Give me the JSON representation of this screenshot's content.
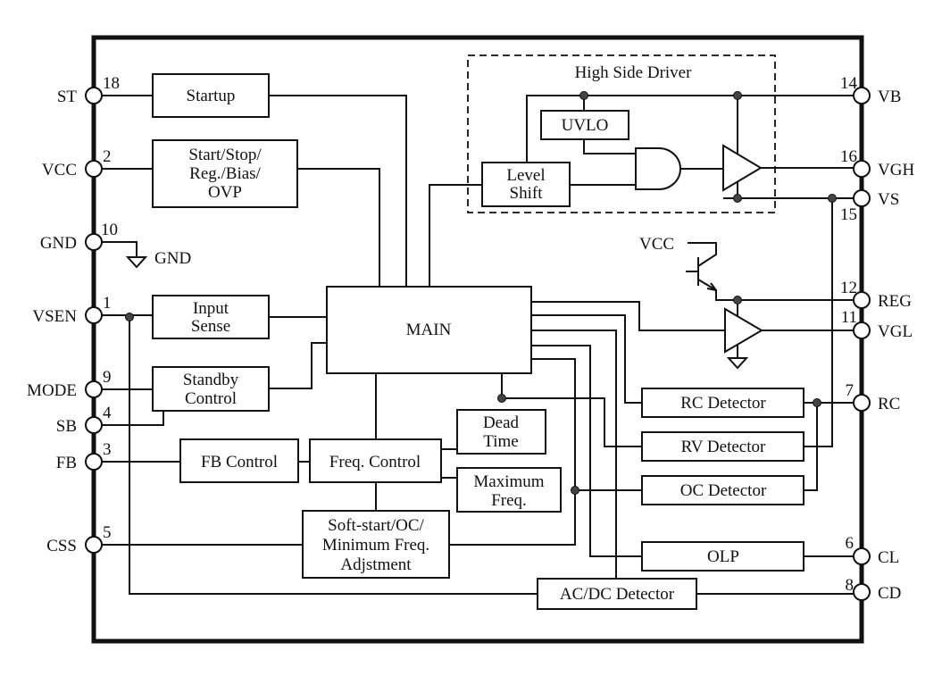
{
  "left_pins": [
    {
      "name": "ST",
      "num": "18"
    },
    {
      "name": "VCC",
      "num": "2"
    },
    {
      "name": "GND",
      "num": "10"
    },
    {
      "name": "VSEN",
      "num": "1"
    },
    {
      "name": "MODE",
      "num": "9"
    },
    {
      "name": "SB",
      "num": "4"
    },
    {
      "name": "FB",
      "num": "3"
    },
    {
      "name": "CSS",
      "num": "5"
    }
  ],
  "right_pins": [
    {
      "name": "VB",
      "num": "14"
    },
    {
      "name": "VGH",
      "num": "16"
    },
    {
      "name": "VS",
      "num": "15"
    },
    {
      "name": "REG",
      "num": "12"
    },
    {
      "name": "VGL",
      "num": "11"
    },
    {
      "name": "RC",
      "num": "7"
    },
    {
      "name": "CL",
      "num": "6"
    },
    {
      "name": "CD",
      "num": "8"
    }
  ],
  "blocks": {
    "startup": "Startup",
    "start_stop": [
      "Start/Stop/",
      "Reg./Bias/",
      "OVP"
    ],
    "input_sense": [
      "Input",
      "Sense"
    ],
    "standby": [
      "Standby",
      "Control"
    ],
    "fb_control": "FB Control",
    "freq_control": "Freq. Control",
    "main": "MAIN",
    "dead_time": [
      "Dead",
      "Time"
    ],
    "max_freq": [
      "Maximum",
      "Freq."
    ],
    "soft_start": [
      "Soft-start/OC/",
      "Minimum Freq.",
      "Adjstment"
    ],
    "rc_detector": "RC Detector",
    "rv_detector": "RV Detector",
    "oc_detector": "OC Detector",
    "olp": "OLP",
    "acdc": "AC/DC Detector",
    "high_side_driver": "High Side Driver",
    "uvlo": "UVLO",
    "level_shift": [
      "Level",
      "Shift"
    ]
  },
  "labels": {
    "gnd": "GND",
    "vcc": "VCC"
  }
}
